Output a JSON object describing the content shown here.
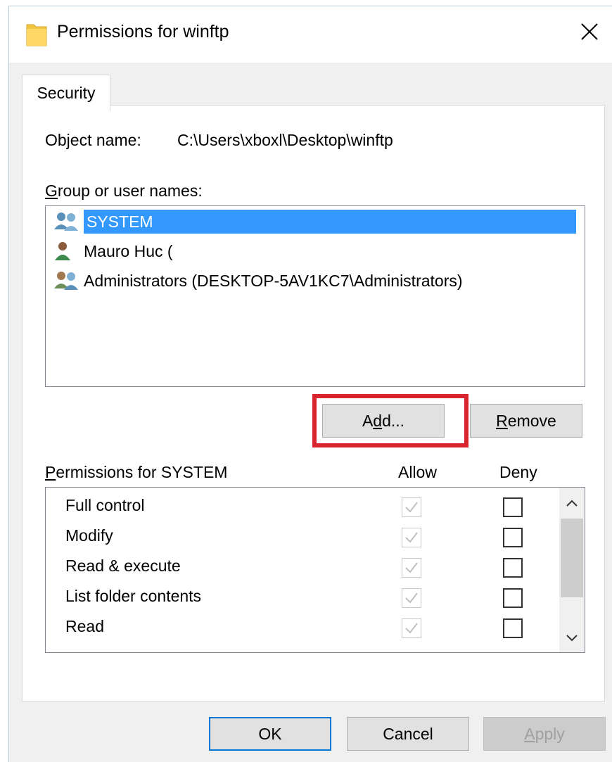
{
  "window": {
    "title": "Permissions for winftp",
    "close_glyph": "✕",
    "folder_icon": "folder-icon",
    "folder_color": "#f4c542"
  },
  "tabs": [
    {
      "label": "Security",
      "selected": true
    }
  ],
  "object": {
    "label": "Object name:",
    "value": "C:\\Users\\xboxl\\Desktop\\winftp"
  },
  "groups": {
    "label": "Group or user names:",
    "items": [
      {
        "name": "SYSTEM",
        "icon": "group-users-icon",
        "selected": true
      },
      {
        "name": "Mauro Huc (",
        "icon": "user-icon",
        "selected": false
      },
      {
        "name": "Administrators (DESKTOP-5AV1KC7\\Administrators)",
        "icon": "group-users-icon",
        "selected": false
      }
    ]
  },
  "buttons": {
    "add": "Add...",
    "remove": "Remove",
    "ok": "OK",
    "cancel": "Cancel",
    "apply": "Apply"
  },
  "permissions": {
    "label": "Permissions for SYSTEM",
    "allow_header": "Allow",
    "deny_header": "Deny",
    "rows": [
      {
        "name": "Full control",
        "allow": true,
        "deny": false
      },
      {
        "name": "Modify",
        "allow": true,
        "deny": false
      },
      {
        "name": "Read & execute",
        "allow": true,
        "deny": false
      },
      {
        "name": "List folder contents",
        "allow": true,
        "deny": false
      },
      {
        "name": "Read",
        "allow": true,
        "deny": false
      }
    ]
  },
  "colors": {
    "selection": "#3399ff",
    "highlight_box": "#d9232e",
    "default_button_border": "#0078d7"
  }
}
